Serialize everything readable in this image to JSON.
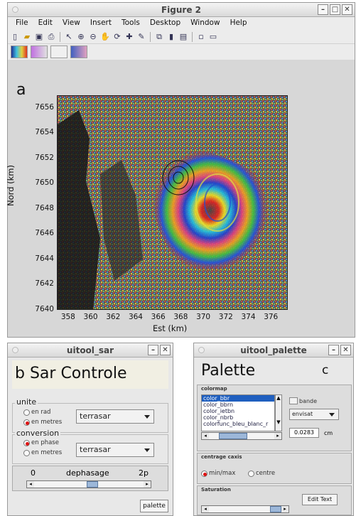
{
  "figure": {
    "title": "Figure 2",
    "menu": [
      "File",
      "Edit",
      "View",
      "Insert",
      "Tools",
      "Desktop",
      "Window",
      "Help"
    ],
    "panel_letter": "a",
    "chart_data": {
      "type": "heatmap",
      "title": "",
      "xlabel": "Est (km)",
      "ylabel": "Nord (km)",
      "xlim": [
        357,
        377.5
      ],
      "ylim": [
        7640,
        7657
      ],
      "xticks": [
        358,
        360,
        362,
        364,
        366,
        368,
        370,
        372,
        374,
        376
      ],
      "yticks": [
        7640,
        7642,
        7644,
        7646,
        7648,
        7650,
        7652,
        7654,
        7656
      ]
    },
    "xtick_labels": [
      "358",
      "360",
      "362",
      "364",
      "366",
      "368",
      "370",
      "372",
      "374",
      "376"
    ],
    "ytick_labels": [
      "7640",
      "7642",
      "7644",
      "7646",
      "7648",
      "7650",
      "7652",
      "7654",
      "7656"
    ]
  },
  "sar": {
    "title": "uitool_sar",
    "heading": "b Sar Controle",
    "unite_label": "unite",
    "radio_rad": "en rad",
    "radio_metres": "en metres",
    "select1": "terrasar",
    "conversion_label": "conversion",
    "radio_phase": "en phase",
    "radio_metres2": "en metres",
    "select2": "terrasar",
    "slider_min": "0",
    "slider_label": "dephasage",
    "slider_max": "2p",
    "palette_button": "palette"
  },
  "palette": {
    "title": "uitool_palette",
    "heading": "Palette",
    "letter": "c",
    "colormap_label": "colormap",
    "list_items": [
      "color_bbr",
      "color_bbrn",
      "color_ietbn",
      "color_nbrb",
      "colorfunc_bleu_blanc_r"
    ],
    "bande_label": "bande",
    "select": "envisat",
    "value": "0.0283",
    "unit": "cm",
    "centrage_label": "centrage caxis",
    "radio_minmax": "min/max",
    "radio_centre": "centre",
    "saturation_label": "Saturation",
    "edit_button": "Edit Text"
  },
  "colors": {
    "accent": "#d11111",
    "select_bg": "#1f5fbf"
  }
}
